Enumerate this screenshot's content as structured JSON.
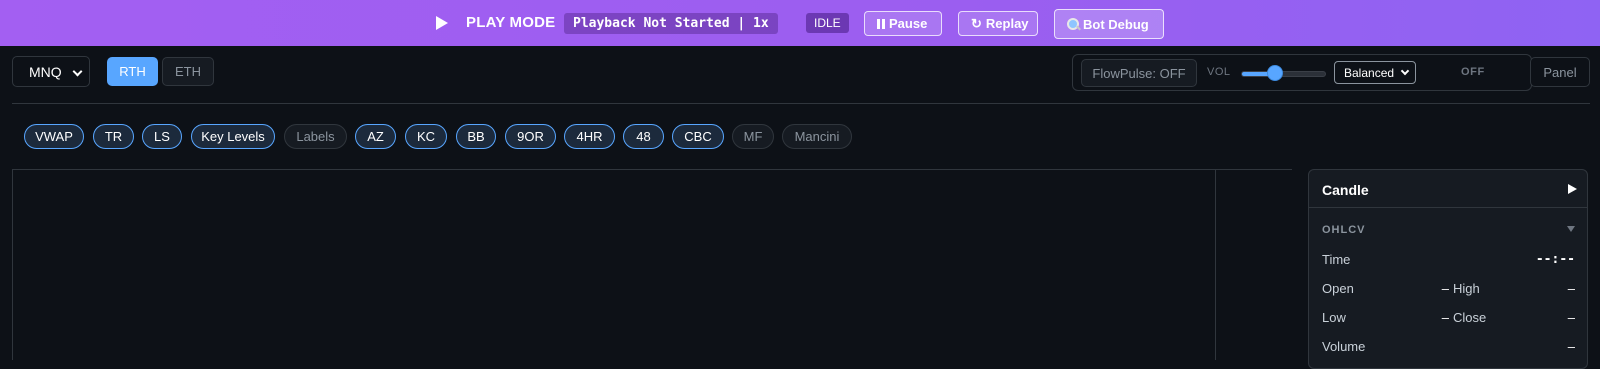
{
  "banner": {
    "mode_label": "PLAY MODE",
    "status_text": "Playback Not Started | 1x",
    "state_badge": "IDLE",
    "pause_label": "Pause",
    "replay_glyph": "↻",
    "replay_label": "Replay",
    "debug_label": "Bot Debug",
    "colors": {
      "gradient_start": "#a35ff2",
      "gradient_end": "#8f63f3"
    }
  },
  "toolbar": {
    "symbol": "MNQ",
    "sessions": [
      {
        "label": "RTH",
        "active": true
      },
      {
        "label": "ETH",
        "active": false
      }
    ],
    "flowpulse_label": "FlowPulse: OFF",
    "vol_label": "VOL",
    "vol_level": 0.4,
    "mode_value": "Balanced",
    "off_label": "OFF",
    "panel_label": "Panel",
    "accent": "#58a6ff"
  },
  "indicators": [
    {
      "label": "VWAP",
      "active": true
    },
    {
      "label": "TR",
      "active": true
    },
    {
      "label": "LS",
      "active": true
    },
    {
      "label": "Key Levels",
      "active": true
    },
    {
      "label": "Labels",
      "active": false
    },
    {
      "label": "AZ",
      "active": true
    },
    {
      "label": "KC",
      "active": true
    },
    {
      "label": "BB",
      "active": true
    },
    {
      "label": "9OR",
      "active": true
    },
    {
      "label": "4HR",
      "active": true
    },
    {
      "label": "48",
      "active": true
    },
    {
      "label": "CBC",
      "active": true
    },
    {
      "label": "MF",
      "active": false
    },
    {
      "label": "Mancini",
      "active": false
    }
  ],
  "candle_panel": {
    "title": "Candle",
    "section": "OHLCV",
    "time_label": "Time",
    "time_value": "--:--",
    "open_label": "Open",
    "open_value": "–",
    "high_label": "High",
    "high_value": "–",
    "low_label": "Low",
    "low_value": "–",
    "close_label": "Close",
    "close_value": "–",
    "volume_label": "Volume",
    "volume_value": "–"
  }
}
